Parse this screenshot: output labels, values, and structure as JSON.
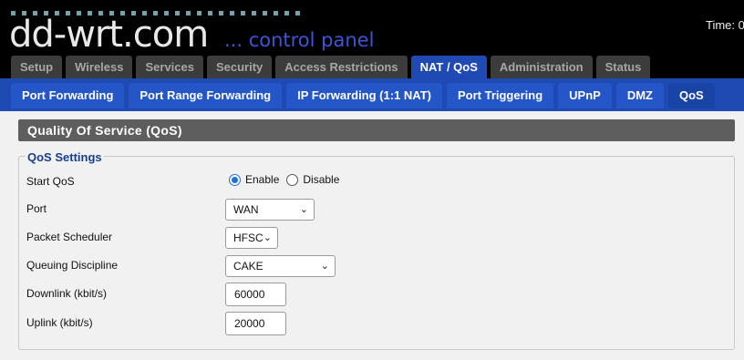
{
  "header": {
    "logo": "dd-wrt.com",
    "subtitle": "... control panel",
    "time": "Time: 0"
  },
  "main_tabs": [
    "Setup",
    "Wireless",
    "Services",
    "Security",
    "Access Restrictions",
    "NAT / QoS",
    "Administration",
    "Status"
  ],
  "main_tabs_active": "NAT / QoS",
  "sub_tabs": [
    "Port Forwarding",
    "Port Range Forwarding",
    "IP Forwarding (1:1 NAT)",
    "Port Triggering",
    "UPnP",
    "DMZ",
    "QoS"
  ],
  "sub_tabs_active": "QoS",
  "section": {
    "title": "Quality Of Service (QoS)",
    "legend": "QoS Settings"
  },
  "fields": {
    "start_qos": {
      "label": "Start QoS",
      "options": [
        "Enable",
        "Disable"
      ],
      "selected": "Enable"
    },
    "port": {
      "label": "Port",
      "value": "WAN"
    },
    "packet_scheduler": {
      "label": "Packet Scheduler",
      "value": "HFSC"
    },
    "queuing_discipline": {
      "label": "Queuing Discipline",
      "value": "CAKE"
    },
    "downlink": {
      "label": "Downlink (kbit/s)",
      "value": "60000"
    },
    "uplink": {
      "label": "Uplink (kbit/s)",
      "value": "20000"
    }
  },
  "colors": {
    "tab_active": "#1f49b3",
    "legend": "#1b3e8c",
    "section_header": "#5e5e5e",
    "logo_sub": "#3b55d8"
  }
}
